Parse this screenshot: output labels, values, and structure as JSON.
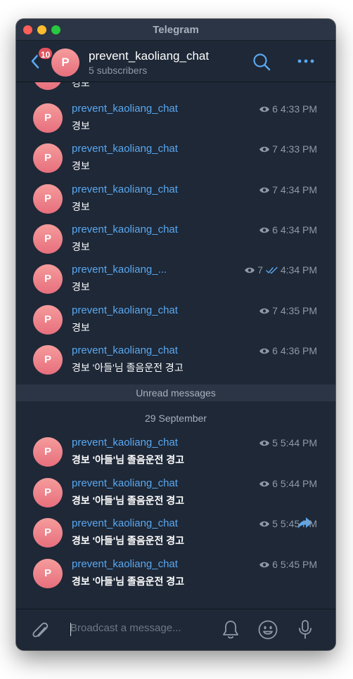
{
  "window": {
    "title": "Telegram"
  },
  "header": {
    "back_badge": "10",
    "avatar_letter": "P",
    "title": "prevent_kaoliang_chat",
    "subtitle": "5 subscribers"
  },
  "partial_top_text": "경보",
  "messages": [
    {
      "avatar": "P",
      "sender": "prevent_kaoliang_chat",
      "text": "경보",
      "views": "6",
      "time": "4:33 PM"
    },
    {
      "avatar": "P",
      "sender": "prevent_kaoliang_chat",
      "text": "경보",
      "views": "7",
      "time": "4:33 PM"
    },
    {
      "avatar": "P",
      "sender": "prevent_kaoliang_chat",
      "text": "경보",
      "views": "7",
      "time": "4:34 PM"
    },
    {
      "avatar": "P",
      "sender": "prevent_kaoliang_chat",
      "text": "경보",
      "views": "6",
      "time": "4:34 PM"
    },
    {
      "avatar": "P",
      "sender": "prevent_kaoliang_...",
      "text": "경보",
      "views": "7",
      "time": "4:34 PM"
    },
    {
      "avatar": "P",
      "sender": "prevent_kaoliang_chat",
      "text": "경보",
      "views": "7",
      "time": "4:35 PM"
    },
    {
      "avatar": "P",
      "sender": "prevent_kaoliang_chat",
      "text": "경보 '아들'님 졸음운전 경고",
      "views": "6",
      "time": "4:36 PM"
    }
  ],
  "unread_label": "Unread messages",
  "date_separator": "29 September",
  "unread_messages": [
    {
      "avatar": "P",
      "sender": "prevent_kaoliang_chat",
      "text": "경보 '아들'님 졸음운전 경고",
      "views": "5",
      "time": "5:44 PM"
    },
    {
      "avatar": "P",
      "sender": "prevent_kaoliang_chat",
      "text": "경보 '아들'님 졸음운전 경고",
      "views": "6",
      "time": "5:44 PM"
    },
    {
      "avatar": "P",
      "sender": "prevent_kaoliang_chat",
      "text": "경보 '아들'님 졸음운전 경고",
      "views": "5",
      "time": "5:45 PM"
    },
    {
      "avatar": "P",
      "sender": "prevent_kaoliang_chat",
      "text": "경보 '아들'님 졸음운전 경고",
      "views": "6",
      "time": "5:45 PM"
    }
  ],
  "composer": {
    "placeholder": "Broadcast a message..."
  },
  "colors": {
    "background": "#1e2837",
    "accent": "#5aa8f0",
    "badge": "#e2535e",
    "avatar": "#ee8490"
  },
  "icons": [
    "chevron-left-icon",
    "search-icon",
    "more-icon",
    "eye-icon",
    "double-check-icon",
    "forward-icon",
    "paperclip-icon",
    "bell-icon",
    "emoji-icon",
    "microphone-icon"
  ]
}
